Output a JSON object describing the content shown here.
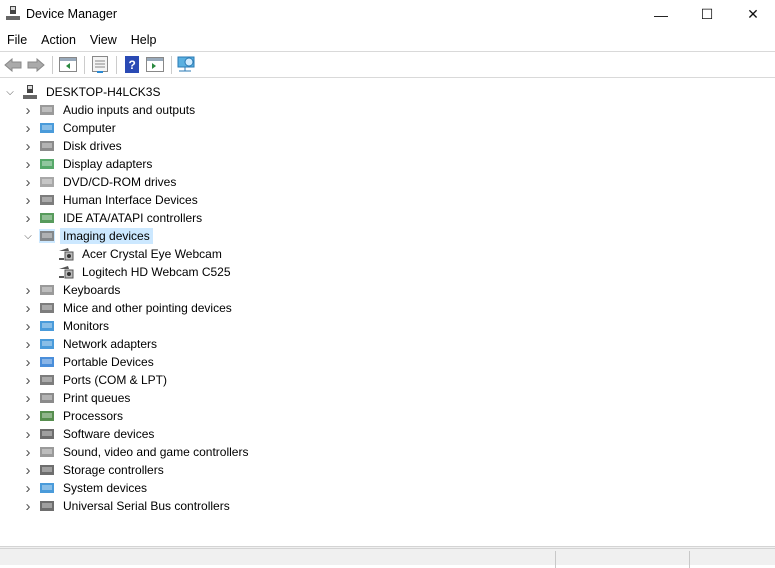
{
  "window": {
    "title": "Device Manager",
    "minimize": "—",
    "maximize": "☐",
    "close": "✕"
  },
  "menu": [
    "File",
    "Action",
    "View",
    "Help"
  ],
  "toolbar": [
    "back-icon",
    "forward-icon",
    "show-hide-console-tree-icon",
    "properties-icon",
    "help-icon",
    "action-pane-icon",
    "scan-hardware-icon"
  ],
  "tree": {
    "root": "DESKTOP-H4LCK3S",
    "categories": [
      {
        "label": "Audio inputs and outputs",
        "icon": "speaker-icon",
        "color": "#888"
      },
      {
        "label": "Computer",
        "icon": "monitor-icon",
        "color": "#2a8ad4"
      },
      {
        "label": "Disk drives",
        "icon": "disk-icon",
        "color": "#777"
      },
      {
        "label": "Display adapters",
        "icon": "display-adapter-icon",
        "color": "#3a9a50"
      },
      {
        "label": "DVD/CD-ROM drives",
        "icon": "dvd-icon",
        "color": "#999"
      },
      {
        "label": "Human Interface Devices",
        "icon": "hid-icon",
        "color": "#666"
      },
      {
        "label": "IDE ATA/ATAPI controllers",
        "icon": "ide-controller-icon",
        "color": "#3a8a40"
      },
      {
        "label": "Imaging devices",
        "icon": "camera-icon",
        "color": "#777",
        "expanded": true,
        "selected": true,
        "children": [
          {
            "label": "Acer Crystal Eye Webcam",
            "icon": "camera-icon"
          },
          {
            "label": "Logitech HD Webcam C525",
            "icon": "camera-icon"
          }
        ]
      },
      {
        "label": "Keyboards",
        "icon": "keyboard-icon",
        "color": "#888"
      },
      {
        "label": "Mice and other pointing devices",
        "icon": "mouse-icon",
        "color": "#666"
      },
      {
        "label": "Monitors",
        "icon": "monitor-icon",
        "color": "#2a8ad4"
      },
      {
        "label": "Network adapters",
        "icon": "network-icon",
        "color": "#2a8ad4"
      },
      {
        "label": "Portable Devices",
        "icon": "portable-device-icon",
        "color": "#2a7ad4"
      },
      {
        "label": "Ports (COM & LPT)",
        "icon": "port-icon",
        "color": "#666"
      },
      {
        "label": "Print queues",
        "icon": "printer-icon",
        "color": "#777"
      },
      {
        "label": "Processors",
        "icon": "processor-icon",
        "color": "#3a7a30"
      },
      {
        "label": "Software devices",
        "icon": "software-device-icon",
        "color": "#555"
      },
      {
        "label": "Sound, video and game controllers",
        "icon": "speaker-icon",
        "color": "#888"
      },
      {
        "label": "Storage controllers",
        "icon": "storage-controller-icon",
        "color": "#555"
      },
      {
        "label": "System devices",
        "icon": "system-device-icon",
        "color": "#2a8ad4"
      },
      {
        "label": "Universal Serial Bus controllers",
        "icon": "usb-icon",
        "color": "#555"
      }
    ]
  }
}
